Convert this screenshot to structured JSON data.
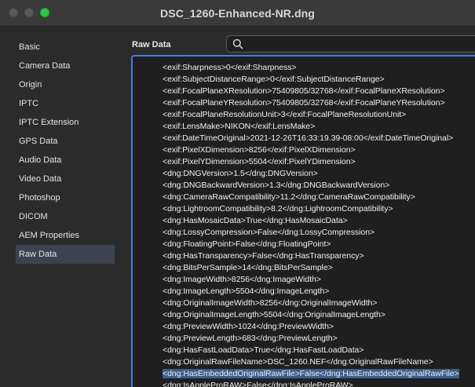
{
  "window": {
    "title": "DSC_1260-Enhanced-NR.dng"
  },
  "sidebar": {
    "items": [
      {
        "label": "Basic"
      },
      {
        "label": "Camera Data"
      },
      {
        "label": "Origin"
      },
      {
        "label": "IPTC"
      },
      {
        "label": "IPTC Extension"
      },
      {
        "label": "GPS Data"
      },
      {
        "label": "Audio Data"
      },
      {
        "label": "Video Data"
      },
      {
        "label": "Photoshop"
      },
      {
        "label": "DICOM"
      },
      {
        "label": "AEM Properties"
      },
      {
        "label": "Raw Data"
      }
    ],
    "selected": "Raw Data"
  },
  "main": {
    "section_label": "Raw Data",
    "search": {
      "value": "",
      "placeholder": ""
    },
    "raw_lines": [
      "<exif:Sharpness>0</exif:Sharpness>",
      "<exif:SubjectDistanceRange>0</exif:SubjectDistanceRange>",
      "<exif:FocalPlaneXResolution>75409805/32768</exif:FocalPlaneXResolution>",
      "<exif:FocalPlaneYResolution>75409805/32768</exif:FocalPlaneYResolution>",
      "<exif:FocalPlaneResolutionUnit>3</exif:FocalPlaneResolutionUnit>",
      "<exif:LensMake>NIKON</exif:LensMake>",
      "<exif:DateTimeOriginal>2021-12-26T16:33:19.39-08:00</exif:DateTimeOriginal>",
      "<exif:PixelXDimension>8256</exif:PixelXDimension>",
      "<exif:PixelYDimension>5504</exif:PixelYDimension>",
      "<dng:DNGVersion>1.5</dng:DNGVersion>",
      "<dng:DNGBackwardVersion>1.3</dng:DNGBackwardVersion>",
      "<dng:CameraRawCompatibility>11.2</dng:CameraRawCompatibility>",
      "<dng:LightroomCompatibility>8.2</dng:LightroomCompatibility>",
      "<dng:HasMosaicData>True</dng:HasMosaicData>",
      "<dng:LossyCompression>False</dng:LossyCompression>",
      "<dng:FloatingPoint>False</dng:FloatingPoint>",
      "<dng:HasTransparency>False</dng:HasTransparency>",
      "<dng:BitsPerSample>14</dng:BitsPerSample>",
      "<dng:ImageWidth>8256</dng:ImageWidth>",
      "<dng:ImageLength>5504</dng:ImageLength>",
      "<dng:OriginalImageWidth>8256</dng:OriginalImageWidth>",
      "<dng:OriginalImageLength>5504</dng:OriginalImageLength>",
      "<dng:PreviewWidth>1024</dng:PreviewWidth>",
      "<dng:PreviewLength>683</dng:PreviewLength>",
      "<dng:HasFastLoadData>True</dng:HasFastLoadData>",
      "<dng:OriginalRawFileName>DSC_1260.NEF</dng:OriginalRawFileName>",
      "<dng:HasEmbeddedOriginalRawFile>False</dng:HasEmbeddedOriginalRawFile>",
      "<dng:IsAppleProRAW>False</dng:IsAppleProRAW>"
    ],
    "selected_line": 26
  },
  "icons": {
    "search": "search-icon"
  },
  "colors": {
    "accent": "#3f7fe0",
    "selection": "#3a5e8c",
    "zoom_button": "#28c840"
  }
}
